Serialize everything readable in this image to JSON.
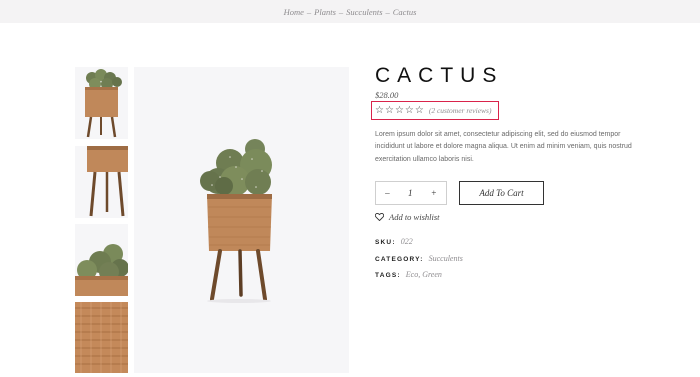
{
  "breadcrumb": {
    "items": [
      "Home",
      "Plants",
      "Succulents",
      "Cactus"
    ],
    "separator": "–"
  },
  "product": {
    "title": "CACTUS",
    "price": "$28.00",
    "rating": {
      "stars_filled": 0,
      "stars_total": 5,
      "reviews_label": "(2 customer reviews)"
    },
    "description": "Lorem ipsum dolor sit amet, consectetur adipiscing elit, sed do eiusmod tempor incididunt ut labore et dolore magna aliqua. Ut enim ad minim veniam, quis nostrud exercitation ullamco laboris nisi.",
    "quantity": {
      "minus": "–",
      "value": "1",
      "plus": "+"
    },
    "add_to_cart_label": "Add To Cart",
    "wishlist_label": "Add to wishlist",
    "meta": {
      "sku_key": "SKU:",
      "sku_value": "022",
      "category_key": "CATEGORY:",
      "category_value": "Succulents",
      "tags_key": "TAGS:",
      "tags_value": "Eco, Green"
    }
  },
  "colors": {
    "highlight": "#d9234a",
    "topbar_bg": "#f4f3f4",
    "muted_text": "#8e8c8f"
  }
}
